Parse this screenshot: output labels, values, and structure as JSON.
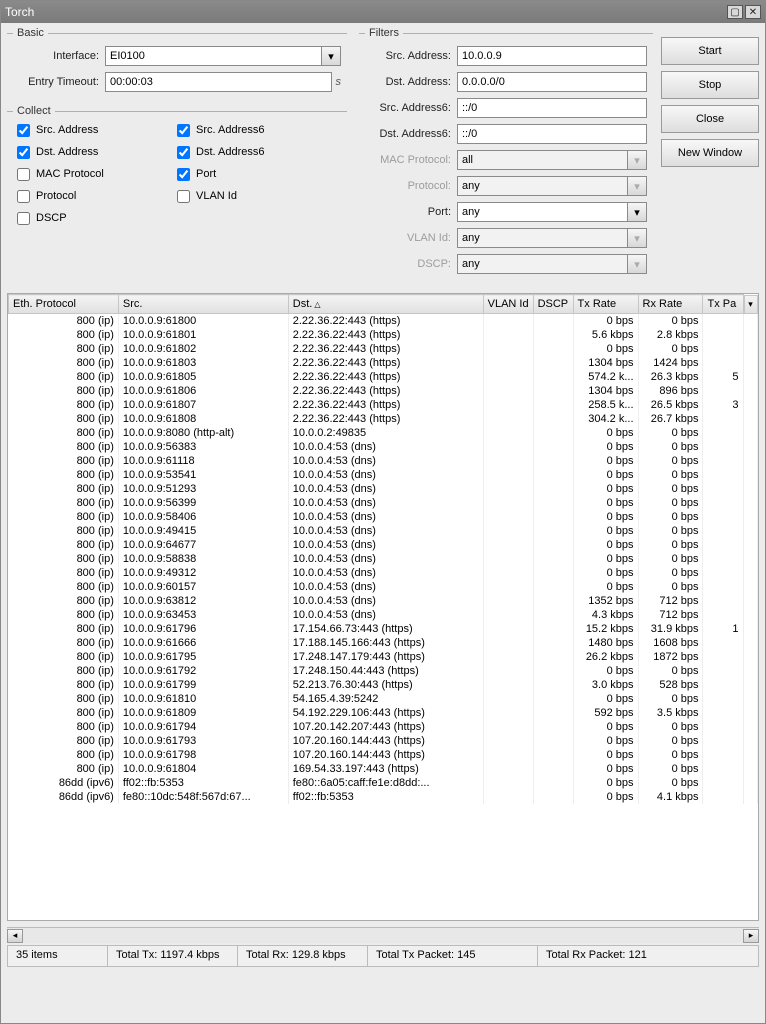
{
  "title": "Torch",
  "buttons": {
    "start": "Start",
    "stop": "Stop",
    "close": "Close",
    "newwindow": "New Window"
  },
  "basic": {
    "legend": "Basic",
    "interface_label": "Interface:",
    "interface_value": "EI0100",
    "entry_timeout_label": "Entry Timeout:",
    "entry_timeout_value": "00:00:03",
    "entry_timeout_unit": "s"
  },
  "collect": {
    "legend": "Collect",
    "items": [
      {
        "label": "Src. Address",
        "checked": true
      },
      {
        "label": "Dst. Address",
        "checked": true
      },
      {
        "label": "MAC Protocol",
        "checked": false
      },
      {
        "label": "Protocol",
        "checked": false
      },
      {
        "label": "DSCP",
        "checked": false
      },
      {
        "label": "Src. Address6",
        "checked": true
      },
      {
        "label": "Dst. Address6",
        "checked": true
      },
      {
        "label": "Port",
        "checked": true
      },
      {
        "label": "VLAN Id",
        "checked": false
      }
    ]
  },
  "filters": {
    "legend": "Filters",
    "src_address_label": "Src. Address:",
    "src_address": "10.0.0.9",
    "dst_address_label": "Dst. Address:",
    "dst_address": "0.0.0.0/0",
    "src_address6_label": "Src. Address6:",
    "src_address6": "::/0",
    "dst_address6_label": "Dst. Address6:",
    "dst_address6": "::/0",
    "mac_protocol_label": "MAC Protocol:",
    "mac_protocol": "all",
    "protocol_label": "Protocol:",
    "protocol": "any",
    "port_label": "Port:",
    "port": "any",
    "vlan_label": "VLAN Id:",
    "vlan": "any",
    "dscp_label": "DSCP:",
    "dscp": "any"
  },
  "columns": [
    "Eth. Protocol",
    "Src.",
    "Dst.",
    "VLAN Id",
    "DSCP",
    "Tx Rate",
    "Rx Rate",
    "Tx Pa"
  ],
  "rows": [
    {
      "eth": "800 (ip)",
      "src": "10.0.0.9:61800",
      "dst": "2.22.36.22:443 (https)",
      "vlan": "",
      "dscp": "",
      "tx": "0 bps",
      "rx": "0 bps",
      "txp": ""
    },
    {
      "eth": "800 (ip)",
      "src": "10.0.0.9:61801",
      "dst": "2.22.36.22:443 (https)",
      "vlan": "",
      "dscp": "",
      "tx": "5.6 kbps",
      "rx": "2.8 kbps",
      "txp": ""
    },
    {
      "eth": "800 (ip)",
      "src": "10.0.0.9:61802",
      "dst": "2.22.36.22:443 (https)",
      "vlan": "",
      "dscp": "",
      "tx": "0 bps",
      "rx": "0 bps",
      "txp": ""
    },
    {
      "eth": "800 (ip)",
      "src": "10.0.0.9:61803",
      "dst": "2.22.36.22:443 (https)",
      "vlan": "",
      "dscp": "",
      "tx": "1304 bps",
      "rx": "1424 bps",
      "txp": ""
    },
    {
      "eth": "800 (ip)",
      "src": "10.0.0.9:61805",
      "dst": "2.22.36.22:443 (https)",
      "vlan": "",
      "dscp": "",
      "tx": "574.2 k...",
      "rx": "26.3 kbps",
      "txp": "5"
    },
    {
      "eth": "800 (ip)",
      "src": "10.0.0.9:61806",
      "dst": "2.22.36.22:443 (https)",
      "vlan": "",
      "dscp": "",
      "tx": "1304 bps",
      "rx": "896 bps",
      "txp": ""
    },
    {
      "eth": "800 (ip)",
      "src": "10.0.0.9:61807",
      "dst": "2.22.36.22:443 (https)",
      "vlan": "",
      "dscp": "",
      "tx": "258.5 k...",
      "rx": "26.5 kbps",
      "txp": "3"
    },
    {
      "eth": "800 (ip)",
      "src": "10.0.0.9:61808",
      "dst": "2.22.36.22:443 (https)",
      "vlan": "",
      "dscp": "",
      "tx": "304.2 k...",
      "rx": "26.7 kbps",
      "txp": ""
    },
    {
      "eth": "800 (ip)",
      "src": "10.0.0.9:8080 (http-alt)",
      "dst": "10.0.0.2:49835",
      "vlan": "",
      "dscp": "",
      "tx": "0 bps",
      "rx": "0 bps",
      "txp": ""
    },
    {
      "eth": "800 (ip)",
      "src": "10.0.0.9:56383",
      "dst": "10.0.0.4:53 (dns)",
      "vlan": "",
      "dscp": "",
      "tx": "0 bps",
      "rx": "0 bps",
      "txp": ""
    },
    {
      "eth": "800 (ip)",
      "src": "10.0.0.9:61118",
      "dst": "10.0.0.4:53 (dns)",
      "vlan": "",
      "dscp": "",
      "tx": "0 bps",
      "rx": "0 bps",
      "txp": ""
    },
    {
      "eth": "800 (ip)",
      "src": "10.0.0.9:53541",
      "dst": "10.0.0.4:53 (dns)",
      "vlan": "",
      "dscp": "",
      "tx": "0 bps",
      "rx": "0 bps",
      "txp": ""
    },
    {
      "eth": "800 (ip)",
      "src": "10.0.0.9:51293",
      "dst": "10.0.0.4:53 (dns)",
      "vlan": "",
      "dscp": "",
      "tx": "0 bps",
      "rx": "0 bps",
      "txp": ""
    },
    {
      "eth": "800 (ip)",
      "src": "10.0.0.9:56399",
      "dst": "10.0.0.4:53 (dns)",
      "vlan": "",
      "dscp": "",
      "tx": "0 bps",
      "rx": "0 bps",
      "txp": ""
    },
    {
      "eth": "800 (ip)",
      "src": "10.0.0.9:58406",
      "dst": "10.0.0.4:53 (dns)",
      "vlan": "",
      "dscp": "",
      "tx": "0 bps",
      "rx": "0 bps",
      "txp": ""
    },
    {
      "eth": "800 (ip)",
      "src": "10.0.0.9:49415",
      "dst": "10.0.0.4:53 (dns)",
      "vlan": "",
      "dscp": "",
      "tx": "0 bps",
      "rx": "0 bps",
      "txp": ""
    },
    {
      "eth": "800 (ip)",
      "src": "10.0.0.9:64677",
      "dst": "10.0.0.4:53 (dns)",
      "vlan": "",
      "dscp": "",
      "tx": "0 bps",
      "rx": "0 bps",
      "txp": ""
    },
    {
      "eth": "800 (ip)",
      "src": "10.0.0.9:58838",
      "dst": "10.0.0.4:53 (dns)",
      "vlan": "",
      "dscp": "",
      "tx": "0 bps",
      "rx": "0 bps",
      "txp": ""
    },
    {
      "eth": "800 (ip)",
      "src": "10.0.0.9:49312",
      "dst": "10.0.0.4:53 (dns)",
      "vlan": "",
      "dscp": "",
      "tx": "0 bps",
      "rx": "0 bps",
      "txp": ""
    },
    {
      "eth": "800 (ip)",
      "src": "10.0.0.9:60157",
      "dst": "10.0.0.4:53 (dns)",
      "vlan": "",
      "dscp": "",
      "tx": "0 bps",
      "rx": "0 bps",
      "txp": ""
    },
    {
      "eth": "800 (ip)",
      "src": "10.0.0.9:63812",
      "dst": "10.0.0.4:53 (dns)",
      "vlan": "",
      "dscp": "",
      "tx": "1352 bps",
      "rx": "712 bps",
      "txp": ""
    },
    {
      "eth": "800 (ip)",
      "src": "10.0.0.9:63453",
      "dst": "10.0.0.4:53 (dns)",
      "vlan": "",
      "dscp": "",
      "tx": "4.3 kbps",
      "rx": "712 bps",
      "txp": ""
    },
    {
      "eth": "800 (ip)",
      "src": "10.0.0.9:61796",
      "dst": "17.154.66.73:443 (https)",
      "vlan": "",
      "dscp": "",
      "tx": "15.2 kbps",
      "rx": "31.9 kbps",
      "txp": "1"
    },
    {
      "eth": "800 (ip)",
      "src": "10.0.0.9:61666",
      "dst": "17.188.145.166:443 (https)",
      "vlan": "",
      "dscp": "",
      "tx": "1480 bps",
      "rx": "1608 bps",
      "txp": ""
    },
    {
      "eth": "800 (ip)",
      "src": "10.0.0.9:61795",
      "dst": "17.248.147.179:443 (https)",
      "vlan": "",
      "dscp": "",
      "tx": "26.2 kbps",
      "rx": "1872 bps",
      "txp": ""
    },
    {
      "eth": "800 (ip)",
      "src": "10.0.0.9:61792",
      "dst": "17.248.150.44:443 (https)",
      "vlan": "",
      "dscp": "",
      "tx": "0 bps",
      "rx": "0 bps",
      "txp": ""
    },
    {
      "eth": "800 (ip)",
      "src": "10.0.0.9:61799",
      "dst": "52.213.76.30:443 (https)",
      "vlan": "",
      "dscp": "",
      "tx": "3.0 kbps",
      "rx": "528 bps",
      "txp": ""
    },
    {
      "eth": "800 (ip)",
      "src": "10.0.0.9:61810",
      "dst": "54.165.4.39:5242",
      "vlan": "",
      "dscp": "",
      "tx": "0 bps",
      "rx": "0 bps",
      "txp": ""
    },
    {
      "eth": "800 (ip)",
      "src": "10.0.0.9:61809",
      "dst": "54.192.229.106:443 (https)",
      "vlan": "",
      "dscp": "",
      "tx": "592 bps",
      "rx": "3.5 kbps",
      "txp": ""
    },
    {
      "eth": "800 (ip)",
      "src": "10.0.0.9:61794",
      "dst": "107.20.142.207:443 (https)",
      "vlan": "",
      "dscp": "",
      "tx": "0 bps",
      "rx": "0 bps",
      "txp": ""
    },
    {
      "eth": "800 (ip)",
      "src": "10.0.0.9:61793",
      "dst": "107.20.160.144:443 (https)",
      "vlan": "",
      "dscp": "",
      "tx": "0 bps",
      "rx": "0 bps",
      "txp": ""
    },
    {
      "eth": "800 (ip)",
      "src": "10.0.0.9:61798",
      "dst": "107.20.160.144:443 (https)",
      "vlan": "",
      "dscp": "",
      "tx": "0 bps",
      "rx": "0 bps",
      "txp": ""
    },
    {
      "eth": "800 (ip)",
      "src": "10.0.0.9:61804",
      "dst": "169.54.33.197:443 (https)",
      "vlan": "",
      "dscp": "",
      "tx": "0 bps",
      "rx": "0 bps",
      "txp": ""
    },
    {
      "eth": "86dd (ipv6)",
      "src": "ff02::fb:5353",
      "dst": "fe80::6a05:caff:fe1e:d8dd:...",
      "vlan": "",
      "dscp": "",
      "tx": "0 bps",
      "rx": "0 bps",
      "txp": ""
    },
    {
      "eth": "86dd (ipv6)",
      "src": "fe80::10dc:548f:567d:67...",
      "dst": "ff02::fb:5353",
      "vlan": "",
      "dscp": "",
      "tx": "0 bps",
      "rx": "4.1 kbps",
      "txp": ""
    }
  ],
  "status": {
    "items_count": "35 items",
    "total_tx": "Total Tx: 1197.4 kbps",
    "total_rx": "Total Rx: 129.8 kbps",
    "total_tx_packet": "Total Tx Packet: 145",
    "total_rx_packet": "Total Rx Packet: 121"
  }
}
